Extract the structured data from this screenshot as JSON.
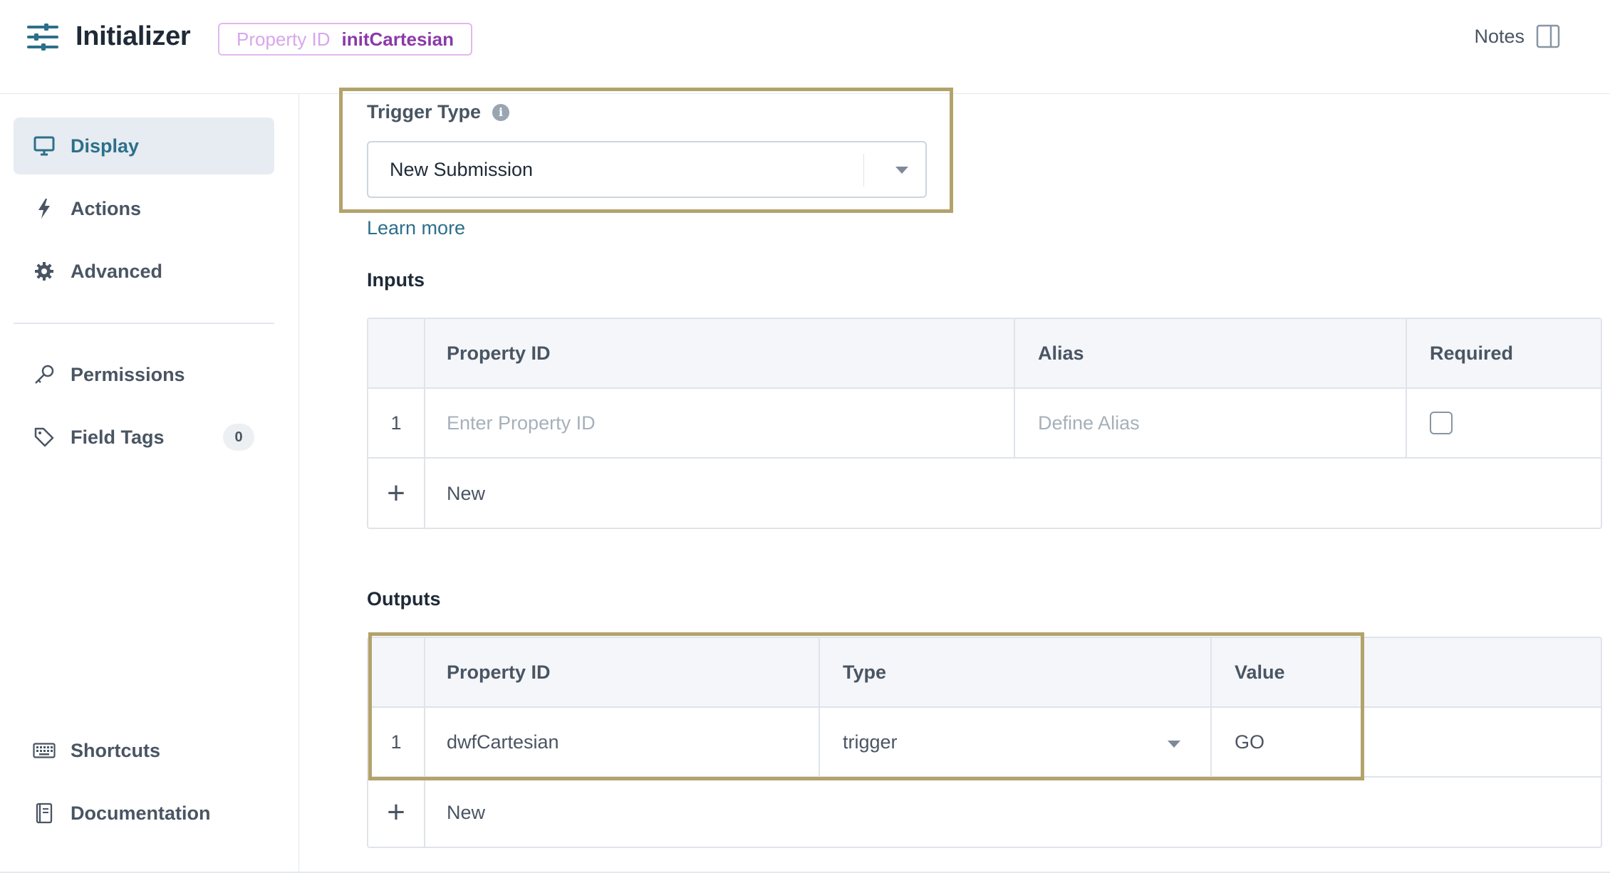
{
  "header": {
    "title": "Initializer",
    "property_label": "Property ID",
    "property_value": "initCartesian",
    "notes_label": "Notes"
  },
  "sidebar": {
    "items": [
      {
        "label": "Display",
        "icon": "monitor-icon",
        "active": true
      },
      {
        "label": "Actions",
        "icon": "lightning-icon"
      },
      {
        "label": "Advanced",
        "icon": "gear-icon"
      },
      {
        "label": "Permissions",
        "icon": "key-icon"
      },
      {
        "label": "Field Tags",
        "icon": "tag-icon",
        "badge": "0"
      },
      {
        "label": "Shortcuts",
        "icon": "keyboard-icon"
      },
      {
        "label": "Documentation",
        "icon": "book-icon"
      }
    ]
  },
  "trigger": {
    "label": "Trigger Type",
    "info_icon": "i",
    "value": "New Submission",
    "learn_more": "Learn more"
  },
  "inputs": {
    "title": "Inputs",
    "columns": [
      "Property ID",
      "Alias",
      "Required"
    ],
    "rows": [
      {
        "index": "1",
        "property_placeholder": "Enter Property ID",
        "alias_placeholder": "Define Alias",
        "required": false
      }
    ],
    "new_label": "New",
    "add_icon": "+"
  },
  "outputs": {
    "title": "Outputs",
    "columns": [
      "Property ID",
      "Type",
      "Value"
    ],
    "rows": [
      {
        "index": "1",
        "property_id": "dwfCartesian",
        "type": "trigger",
        "value": "GO"
      }
    ],
    "new_label": "New",
    "add_icon": "+"
  },
  "colors": {
    "accent": "#2d6f8a",
    "highlight_border": "#b3a36b",
    "badge_purple": "#8a3aa8"
  }
}
